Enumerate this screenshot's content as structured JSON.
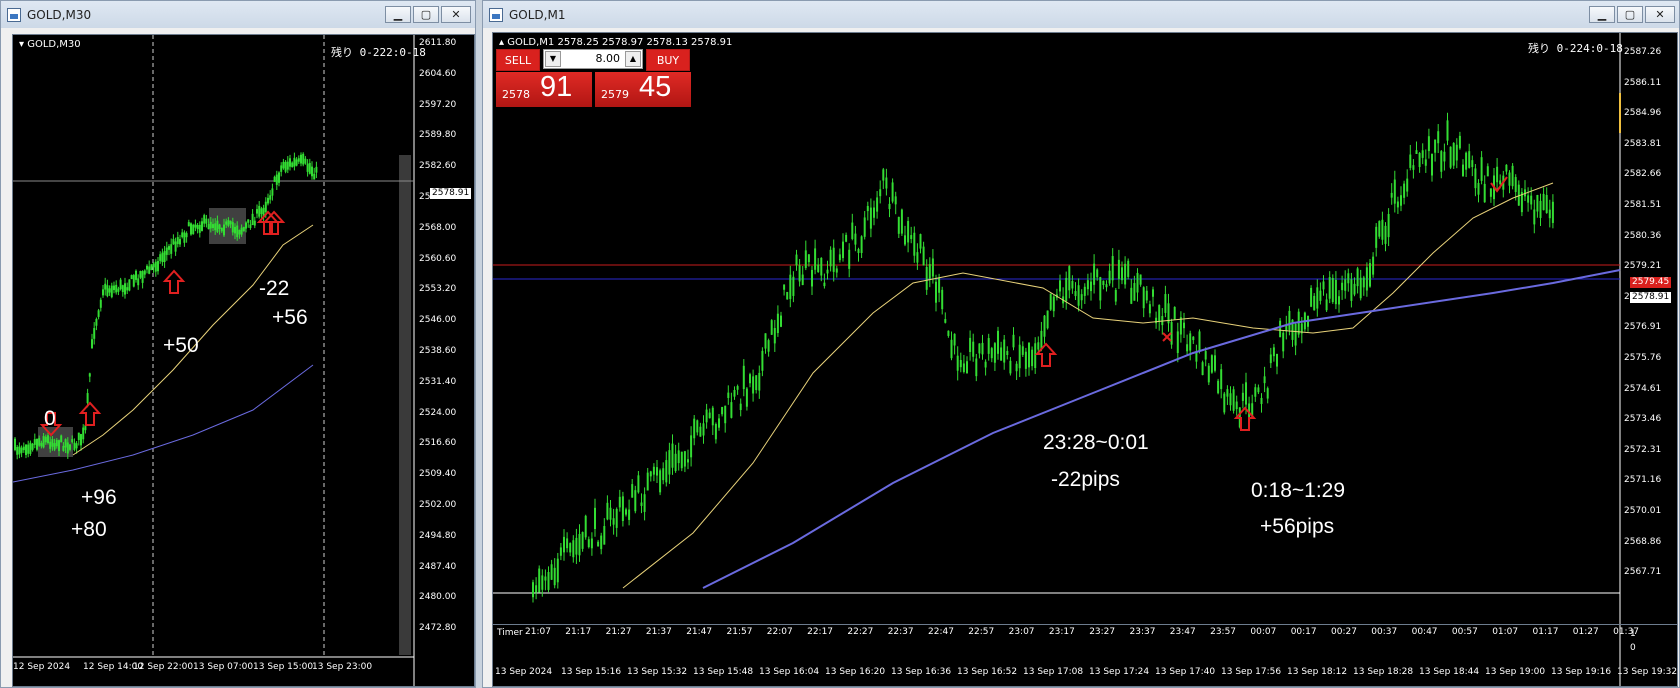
{
  "left": {
    "window_title": "GOLD,M30",
    "chart_label": "GOLD,M30",
    "remaining": "残り 0-222:0-18",
    "price_tag": "2578.91",
    "y_ticks": [
      "2611.80",
      "2604.60",
      "2597.20",
      "2589.80",
      "2582.60",
      "2575.20",
      "2568.00",
      "2560.60",
      "2553.20",
      "2546.00",
      "2538.60",
      "2531.40",
      "2524.00",
      "2516.60",
      "2509.40",
      "2502.00",
      "2494.80",
      "2487.40",
      "2480.00",
      "2472.80"
    ],
    "x_ticks": [
      "12 Sep 2024",
      "12 Sep 14:00",
      "12 Sep 22:00",
      "13 Sep 07:00",
      "13 Sep 15:00",
      "13 Sep 23:00"
    ],
    "notes": [
      "0",
      "+96",
      "+80",
      "+50",
      "-22",
      "+56"
    ]
  },
  "right": {
    "window_title": "GOLD,M1",
    "chart_label": "GOLD,M1  2578.25 2578.97 2578.13 2578.91",
    "remaining": "残り 0-224:0-18",
    "sell_label": "SELL",
    "buy_label": "BUY",
    "lot": "8.00",
    "sell_small": "2578",
    "sell_big": "91",
    "buy_small": "2579",
    "buy_big": "45",
    "price_tag_red": "2579.45",
    "price_tag_blue": "2578.91",
    "y_ticks": [
      "2587.26",
      "2586.11",
      "2584.96",
      "2583.81",
      "2582.66",
      "2581.51",
      "2580.36",
      "2579.21",
      "2578.06",
      "2576.91",
      "2575.76",
      "2574.61",
      "2573.46",
      "2572.31",
      "2571.16",
      "2570.01",
      "2568.86",
      "2567.71"
    ],
    "timer_label": "Timer",
    "timer_ticks": [
      "21:07",
      "21:17",
      "21:27",
      "21:37",
      "21:47",
      "21:57",
      "22:07",
      "22:17",
      "22:27",
      "22:37",
      "22:47",
      "22:57",
      "23:07",
      "23:17",
      "23:27",
      "23:37",
      "23:47",
      "23:57",
      "00:07",
      "00:17",
      "00:27",
      "00:37",
      "00:47",
      "00:57",
      "01:07",
      "01:17",
      "01:27",
      "01:37"
    ],
    "timer_scale": [
      "1",
      "0"
    ],
    "x_ticks": [
      "13 Sep 2024",
      "13 Sep 15:16",
      "13 Sep 15:32",
      "13 Sep 15:48",
      "13 Sep 16:04",
      "13 Sep 16:20",
      "13 Sep 16:36",
      "13 Sep 16:52",
      "13 Sep 17:08",
      "13 Sep 17:24",
      "13 Sep 17:40",
      "13 Sep 17:56",
      "13 Sep 18:12",
      "13 Sep 18:28",
      "13 Sep 18:44",
      "13 Sep 19:00",
      "13 Sep 19:16",
      "13 Sep 19:32"
    ],
    "notes": [
      "23:28~0:01",
      "-22pips",
      "0:18~1:29",
      "+56pips"
    ]
  },
  "colors": {
    "candle": "#33dd33",
    "ma_fast": "#e8d27a",
    "ma_slow": "#6a6adf",
    "trade_red": "#d9211e"
  }
}
